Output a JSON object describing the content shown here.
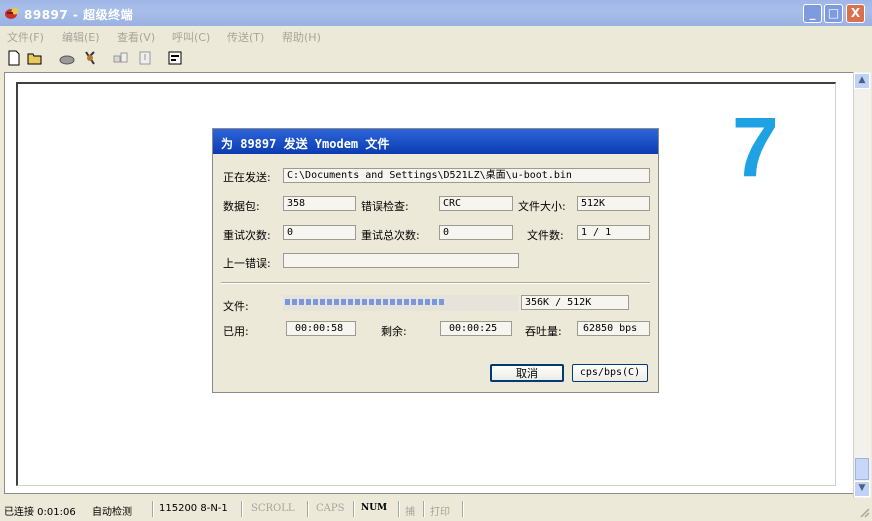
{
  "window": {
    "title": "89897 - 超级终端",
    "controls": {
      "minimize": "_",
      "maximize": "□",
      "close": "X"
    }
  },
  "menu": [
    "文件(F)",
    "编辑(E)",
    "查看(V)",
    "呼叫(C)",
    "传送(T)",
    "帮助(H)"
  ],
  "toolbar_icons": [
    "new-icon",
    "open-icon",
    "dial-icon",
    "disconnect-icon",
    "send-icon",
    "receive-icon",
    "properties-icon"
  ],
  "overlay": {
    "number": "7"
  },
  "dialog": {
    "title": "为 89897 发送 Ymodem 文件",
    "sending_label": "正在发送:",
    "sending_value": "C:\\Documents and Settings\\D521LZ\\桌面\\u-boot.bin",
    "packet_label": "数据包:",
    "packet_value": "358",
    "error_check_label": "错误检查:",
    "error_check_value": "CRC",
    "file_size_label": "文件大小:",
    "file_size_value": "512K",
    "retries_label": "重试次数:",
    "retries_value": "0",
    "total_retries_label": "重试总次数:",
    "total_retries_value": "0",
    "files_label": "文件数:",
    "files_value": "1 / 1",
    "last_error_label": "上一错误:",
    "last_error_value": "",
    "file_label": "文件:",
    "progress_fraction": 0.695,
    "progress_text": "356K / 512K",
    "elapsed_label": "已用:",
    "elapsed_value": "00:00:58",
    "remaining_label": "剩余:",
    "remaining_value": "00:00:25",
    "throughput_label": "吞吐量:",
    "throughput_value": "62850 bps",
    "cancel_button": "取消",
    "cps_button": "cps/bps(C)"
  },
  "statusbar": {
    "connected": "已连接 0:01:06",
    "detect": "自动检测",
    "port": "115200 8-N-1",
    "scroll": "SCROLL",
    "caps": "CAPS",
    "num": "NUM",
    "capture": "捕",
    "print": "打印"
  },
  "colors": {
    "titlebar": "#9FB6E6",
    "dialog_title": "#0A3CB0",
    "progress": "#7A96DF",
    "overlay_number": "#1EA2E4"
  }
}
